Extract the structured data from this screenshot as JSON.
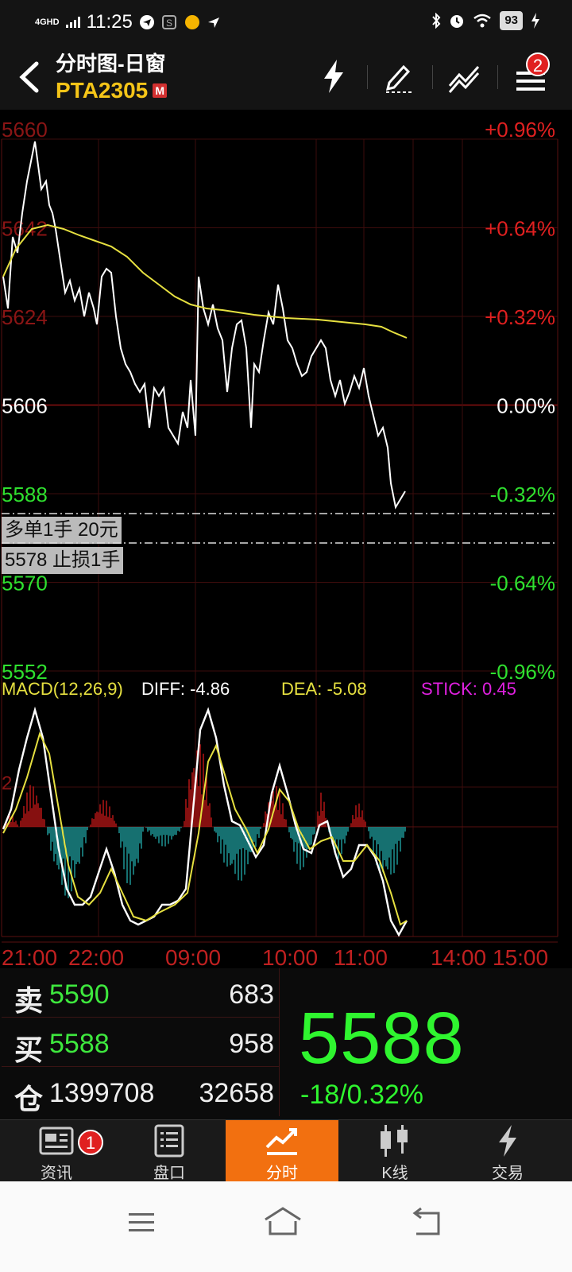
{
  "status_bar": {
    "network": "4GHD",
    "time": "11:25",
    "battery": "93"
  },
  "header": {
    "title": "分时图-日窗",
    "symbol": "PTA2305",
    "market_badge": "M",
    "notification_count": "2"
  },
  "chart": {
    "left_price_labels": [
      "5660",
      "5642",
      "5624",
      "5606",
      "5588",
      "5570",
      "5552"
    ],
    "right_pct_labels": [
      "+0.96%",
      "+0.64%",
      "+0.32%",
      "0.00%",
      "-0.32%",
      "-0.64%",
      "-0.96%"
    ],
    "macd_label": "MACD(12,26,9)",
    "diff_label": "DIFF: -4.86",
    "dea_label": "DEA: -5.08",
    "stick_label": "STICK: 0.45",
    "macd_axis_label": "2",
    "time_labels": [
      "21:00",
      "22:00",
      "09:00",
      "10:00",
      "11:00",
      "14:00",
      "15:00"
    ],
    "order_line_1": "多单1手  20元",
    "order_line_2": "5578 止损1手",
    "colors": {
      "up": "#e02020",
      "down": "#2fe02f",
      "price_line": "#ffffff",
      "avg_line": "#e6e040",
      "dea_line": "#e6e040",
      "macd_neg": "#1fa0a0"
    }
  },
  "quote": {
    "sell_label": "卖",
    "sell_price": "5590",
    "sell_volume": "683",
    "buy_label": "买",
    "buy_price": "5588",
    "buy_volume": "958",
    "position_label": "仓",
    "position_value": "1399708",
    "position_change": "32658",
    "last_price": "5588",
    "change": "-18/0.32%"
  },
  "bottom_nav": {
    "items": [
      {
        "label": "资讯",
        "icon": "news-icon",
        "badge": "1"
      },
      {
        "label": "盘口",
        "icon": "orderbook-icon"
      },
      {
        "label": "分时",
        "icon": "timeshare-icon",
        "active": true
      },
      {
        "label": "K线",
        "icon": "candlestick-icon"
      },
      {
        "label": "交易",
        "icon": "lightning-icon"
      }
    ]
  }
}
